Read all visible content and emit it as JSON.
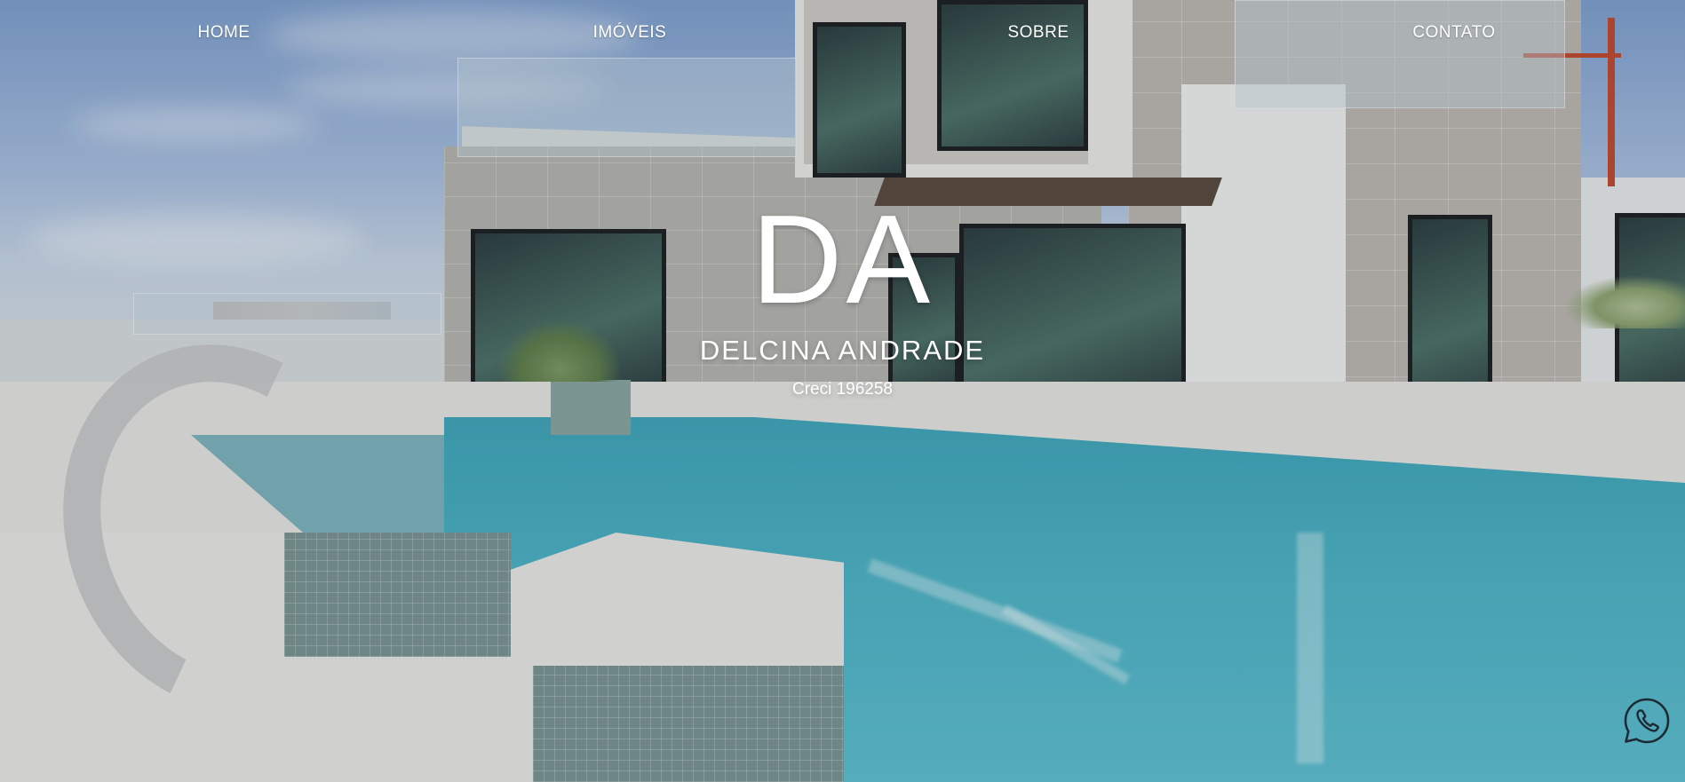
{
  "nav": {
    "items": [
      {
        "label": "HOME"
      },
      {
        "label": "IMÓVEIS"
      },
      {
        "label": "SOBRE"
      },
      {
        "label": "CONTATO"
      }
    ]
  },
  "hero": {
    "monogram": "DA",
    "name": "DELCINA ANDRADE",
    "creci": "Creci 196258"
  },
  "floating": {
    "whatsapp_icon": "whatsapp-icon"
  },
  "colors": {
    "text": "#ffffff",
    "pool": "#4fb4c6",
    "sky": "#a9bfe0"
  }
}
